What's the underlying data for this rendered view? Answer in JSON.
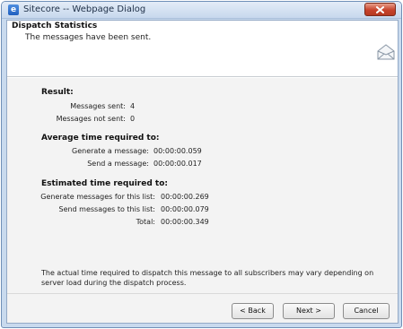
{
  "window": {
    "title": "Sitecore -- Webpage Dialog",
    "icon": "ie-page-icon",
    "close_icon": "close-icon"
  },
  "header": {
    "title": "Dispatch Statistics",
    "subtitle": "The messages have been sent.",
    "icon": "envelope-icon"
  },
  "result": {
    "title": "Result:",
    "rows": [
      {
        "label": "Messages sent:",
        "value": "4"
      },
      {
        "label": "Messages not sent:",
        "value": "0"
      }
    ]
  },
  "average": {
    "title": "Average time required to:",
    "rows": [
      {
        "label": "Generate a message:",
        "value": "00:00:00.059"
      },
      {
        "label": "Send a message:",
        "value": "00:00:00.017"
      }
    ]
  },
  "estimated": {
    "title": "Estimated time required to:",
    "rows": [
      {
        "label": "Generate messages for this list:",
        "value": "00:00:00.269"
      },
      {
        "label": "Send messages to this list:",
        "value": "00:00:00.079"
      },
      {
        "label": "Total:",
        "value": "00:00:00.349"
      }
    ]
  },
  "note": "The actual time required to dispatch this message to all subscribers may vary depending on server load during the dispatch process.",
  "footer": {
    "back_label": "< Back",
    "next_label": "Next >",
    "cancel_label": "Cancel"
  }
}
